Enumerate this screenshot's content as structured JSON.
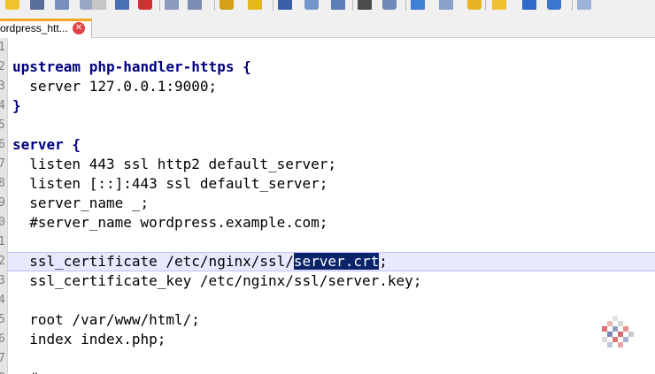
{
  "toolbar": {
    "icons": [
      "open-file-icon",
      "save-icon",
      "save-all-icon",
      "close-icon",
      "close-all-icon",
      "print-icon",
      "delete-icon",
      "indent-icon",
      "outdent-icon",
      "bookmark-icon",
      "star-icon",
      "cut-icon",
      "copy-icon",
      "paste-icon",
      "find-icon",
      "replace-icon",
      "macro-icon",
      "zoom-icon",
      "highlight-icon",
      "settings-icon",
      "wrap-icon",
      "view-icon",
      "more-icon"
    ]
  },
  "tab": {
    "label": "ordpress_htt...",
    "close_glyph": "✕"
  },
  "editor": {
    "line_numbers": [
      "1",
      "2",
      "3",
      "4",
      "5",
      "6",
      "7",
      "8",
      "9",
      "0",
      "1",
      "2",
      "3",
      "4",
      "5",
      "6",
      "7",
      "8"
    ],
    "current_line_index": 11,
    "lines": [
      {
        "segments": []
      },
      {
        "segments": [
          {
            "t": "upstream php-handler-https {",
            "c": "kw"
          }
        ]
      },
      {
        "segments": [
          {
            "t": "  server 127.0.0.1:9000;",
            "c": ""
          }
        ]
      },
      {
        "segments": [
          {
            "t": "}",
            "c": "kw"
          }
        ]
      },
      {
        "segments": []
      },
      {
        "segments": [
          {
            "t": "server {",
            "c": "kw"
          }
        ]
      },
      {
        "segments": [
          {
            "t": "  listen 443 ssl http2 default_server;",
            "c": ""
          }
        ]
      },
      {
        "segments": [
          {
            "t": "  listen [::]:443 ssl default_server;",
            "c": ""
          }
        ]
      },
      {
        "segments": [
          {
            "t": "  server_name _;",
            "c": ""
          }
        ]
      },
      {
        "segments": [
          {
            "t": "  #server_name wordpress.example.com;",
            "c": ""
          }
        ]
      },
      {
        "segments": []
      },
      {
        "segments": [
          {
            "t": "  ssl_certificate /etc/nginx/ssl/",
            "c": ""
          },
          {
            "t": "server.crt",
            "c": "sel"
          },
          {
            "t": ";",
            "c": ""
          }
        ]
      },
      {
        "segments": [
          {
            "t": "  ssl_certificate_key /etc/nginx/ssl/server.key;",
            "c": ""
          }
        ]
      },
      {
        "segments": []
      },
      {
        "segments": [
          {
            "t": "  root /var/www/html/;",
            "c": ""
          }
        ]
      },
      {
        "segments": [
          {
            "t": "  index index.php;",
            "c": ""
          }
        ]
      },
      {
        "segments": []
      },
      {
        "segments": [
          {
            "t": "  #",
            "c": ""
          }
        ]
      }
    ]
  },
  "colors": {
    "keyword": "#000080",
    "selection_bg": "#0a246a",
    "current_line_bg": "#e8e8ff",
    "tab_accent": "#f5a623",
    "tab_close": "#e04343"
  }
}
